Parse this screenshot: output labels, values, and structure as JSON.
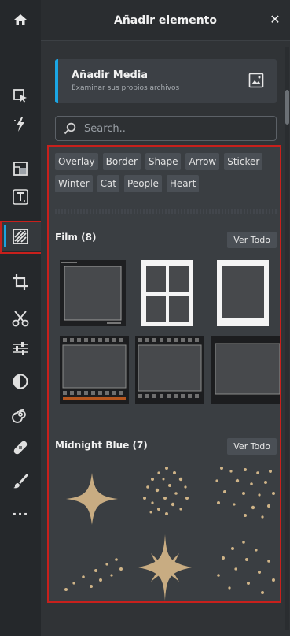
{
  "header": {
    "title": "Añadir elemento",
    "close_glyph": "✕"
  },
  "rail": {
    "items": [
      {
        "name": "home-icon"
      },
      {
        "name": "select-icon"
      },
      {
        "name": "magic-icon"
      },
      {
        "name": "frame-icon"
      },
      {
        "name": "text-icon"
      },
      {
        "name": "texture-icon"
      },
      {
        "name": "crop-icon"
      },
      {
        "name": "cut-icon"
      },
      {
        "name": "adjust-icon"
      },
      {
        "name": "contrast-icon"
      },
      {
        "name": "spiral-icon"
      },
      {
        "name": "bandage-icon"
      },
      {
        "name": "brush-icon"
      },
      {
        "name": "more-icon"
      }
    ],
    "more_glyph": "···"
  },
  "media": {
    "title": "Añadir Media",
    "subtitle": "Examinar sus propios archivos"
  },
  "search": {
    "placeholder": "Search.."
  },
  "tags": [
    "Overlay",
    "Border",
    "Shape",
    "Arrow",
    "Sticker",
    "Winter",
    "Cat",
    "People",
    "Heart"
  ],
  "sections": [
    {
      "title": "Film (8)",
      "see_all": "Ver Todo"
    },
    {
      "title": "Midnight Blue (7)",
      "see_all": "Ver Todo"
    }
  ],
  "colors": {
    "accent": "#1ba6e4",
    "highlight": "#c8201c",
    "gold": "#c8ac82"
  }
}
